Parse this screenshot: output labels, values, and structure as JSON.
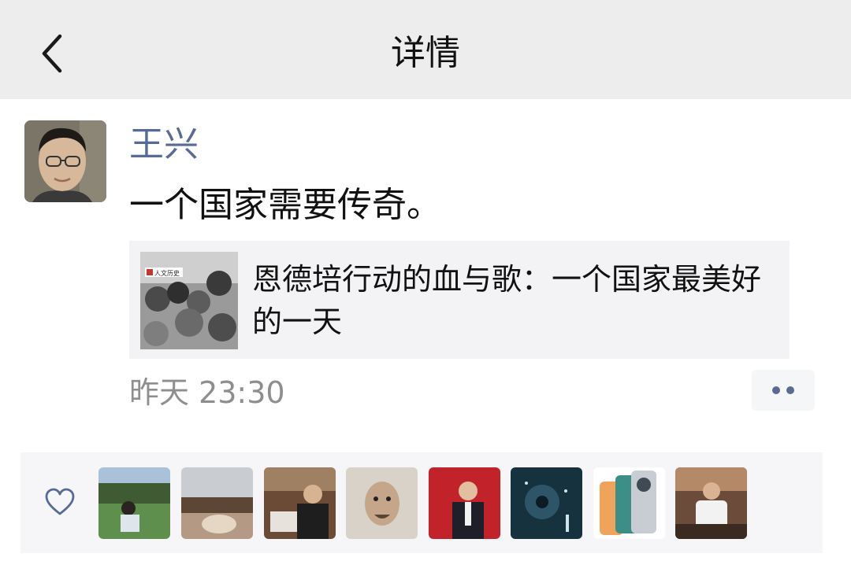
{
  "nav": {
    "title": "详情",
    "back_icon": "chevron-left-icon"
  },
  "post": {
    "author": "王兴",
    "text": "一个国家需要传奇。",
    "share": {
      "title": "恩德培行动的血与歌：一个国家最美好的一天",
      "thumb_badge": "人文历史"
    },
    "timestamp": "昨天 23:30",
    "more_icon": "more-dots-icon"
  },
  "likes": {
    "icon": "heart-icon",
    "users": [
      {
        "alt": "liker-1"
      },
      {
        "alt": "liker-2"
      },
      {
        "alt": "liker-3"
      },
      {
        "alt": "liker-4"
      },
      {
        "alt": "liker-5"
      },
      {
        "alt": "liker-6"
      },
      {
        "alt": "liker-7"
      },
      {
        "alt": "liker-8"
      }
    ]
  },
  "colors": {
    "link": "#576b95",
    "navbar": "#ededed",
    "card": "#f3f3f5",
    "meta": "#8e8e8e"
  }
}
